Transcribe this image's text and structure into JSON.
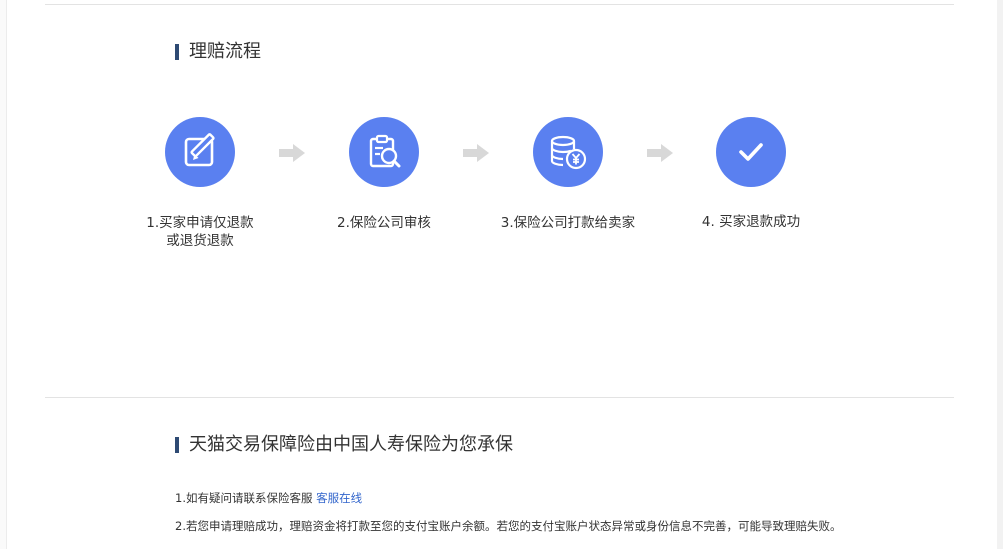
{
  "process": {
    "title": "理赔流程",
    "steps": [
      {
        "label": "1.买家申请仅退款\n或退货退款",
        "icon": "edit-icon"
      },
      {
        "label": "2.保险公司审核",
        "icon": "document-search-icon"
      },
      {
        "label": "3.保险公司打款给卖家",
        "icon": "coins-yuan-icon"
      },
      {
        "label": "4. 买家退款成功",
        "icon": "check-icon"
      }
    ],
    "colors": {
      "circle": "#5a80f0",
      "arrow": "#d8d8d8",
      "title_bar": "#2e4a73"
    }
  },
  "insurer": {
    "title": "天猫交易保障险由中国人寿保险为您承保",
    "note1_text": "1.如有疑问请联系保险客服 ",
    "note1_link": "客服在线",
    "note2": "2.若您申请理赔成功，理赔资金将打款至您的支付宝账户余额。若您的支付宝账户状态异常或身份信息不完善，可能导致理赔失败。",
    "link_color": "#3366cc"
  }
}
